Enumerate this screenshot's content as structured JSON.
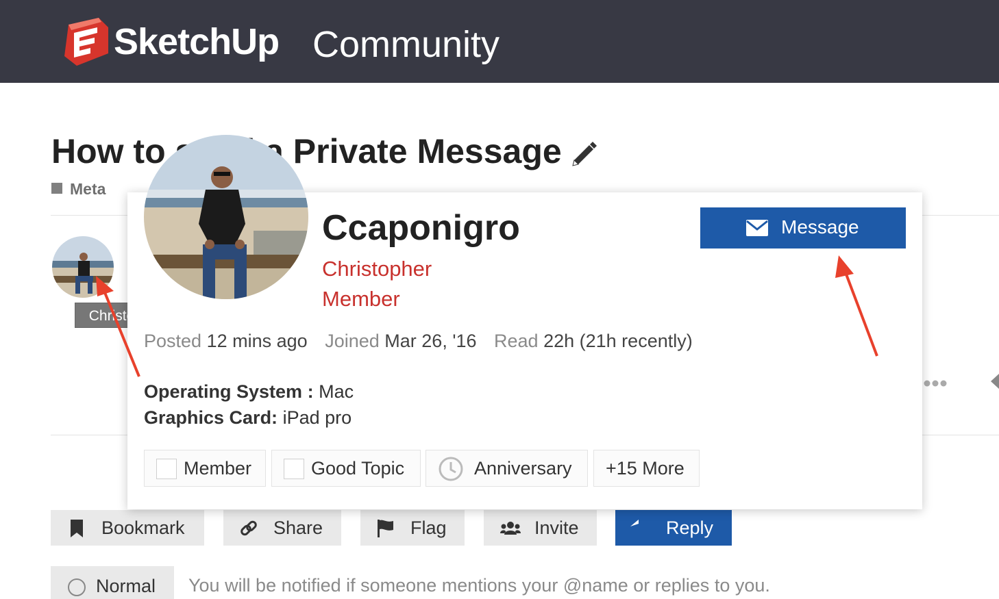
{
  "header": {
    "brand": "SketchUp",
    "section": "Community"
  },
  "topic": {
    "title": "How to send a Private Message",
    "category": "Meta"
  },
  "post": {
    "author_tooltip": "Christopher"
  },
  "user_card": {
    "username": "Ccaponigro",
    "name": "Christopher",
    "title": "Member",
    "message_label": "Message",
    "stats": [
      {
        "key": "Posted",
        "value": "12 mins ago"
      },
      {
        "key": "Joined",
        "value": "Mar 26, '16"
      },
      {
        "key": "Read",
        "value": "22h (21h recently)"
      }
    ],
    "fields": [
      {
        "label": "Operating System :",
        "value": "Mac"
      },
      {
        "label": "Graphics Card:",
        "value": "iPad pro"
      }
    ],
    "badges": [
      "Member",
      "Good Topic",
      "Anniversary",
      "+15 More"
    ]
  },
  "footer_buttons": {
    "bookmark": "Bookmark",
    "share": "Share",
    "flag": "Flag",
    "invite": "Invite",
    "reply": "Reply"
  },
  "notification": {
    "level": "Normal",
    "description": "You will be notified if someone mentions your @name or replies to you."
  },
  "colors": {
    "header_bg": "#383944",
    "primary_button": "#1e5aa8",
    "user_name_red": "#c8312d",
    "annotation_arrow": "#e8412c",
    "logo_red": "#d7352c"
  }
}
